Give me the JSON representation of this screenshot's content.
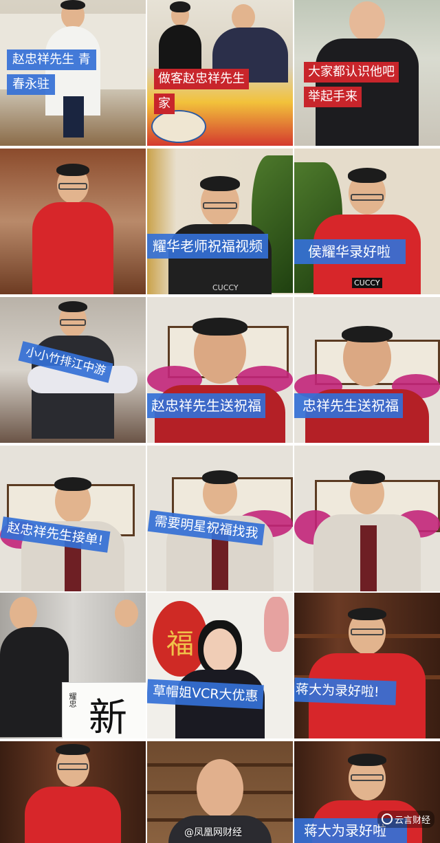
{
  "captions": {
    "c1_line1": "赵忠祥先生 青",
    "c1_line2": "春永驻",
    "c2_line1": "做客赵忠祥先生",
    "c2_line2": "家",
    "c3_line1": "大家都认识他吧",
    "c3_line2": "举起手来",
    "c5": "耀华老师祝福视频",
    "c6": "侯耀华录好啦",
    "c7": "小小竹排江中游",
    "c8": "赵忠祥先生送祝福",
    "c9": "忠祥先生送祝福",
    "c10": "赵忠祥先生接单!",
    "c11": "需要明星祝福找我",
    "c14": "草帽姐VCR大优惠",
    "c15": "蒋大为录好啦!",
    "c18": "蒋大为录好啦"
  },
  "signs": {
    "fu": "福",
    "calligraphy": "新",
    "calligraphy_small": "耀忠"
  },
  "shirt_text": "CUCCY",
  "watermark": {
    "center": "@凤凰网财经",
    "right": "云言财经"
  },
  "colors": {
    "caption_red": "#c8252b",
    "caption_blue": "#3470d6",
    "jacket_red": "#d7262a"
  }
}
